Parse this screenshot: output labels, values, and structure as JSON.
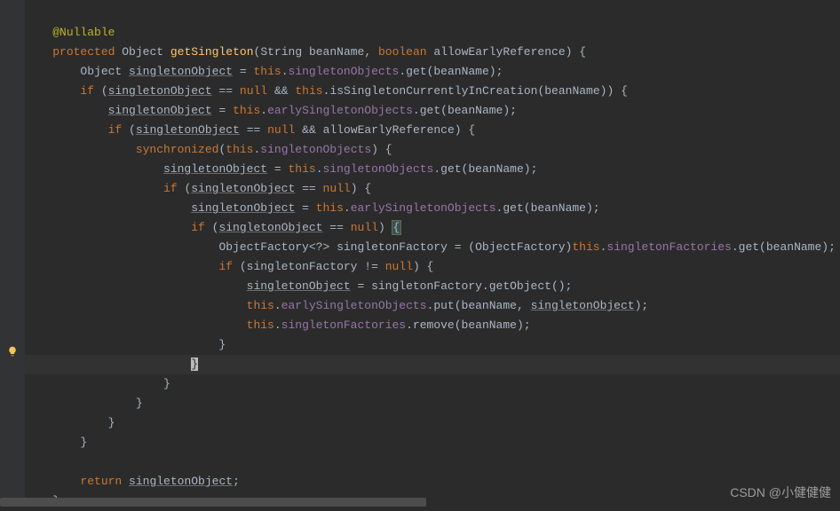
{
  "code": {
    "annotation": "@Nullable",
    "modifiers": {
      "protected": "protected",
      "object": "Object"
    },
    "methodName": "getSingleton",
    "params": {
      "stringType": "String",
      "beanName": "beanName",
      "boolType": "boolean",
      "allowEarly": "allowEarlyReference"
    },
    "kw": {
      "if": "if",
      "this": "this",
      "null": "null",
      "return": "return",
      "sync": "synchronized"
    },
    "id": {
      "singletonObject": "singletonObject",
      "singletonObjects": "singletonObjects",
      "earlySingletonObjects": "earlySingletonObjects",
      "singletonFactories": "singletonFactories",
      "singletonFactory": "singletonFactory",
      "isSingletonCurrentlyInCreation": "isSingletonCurrentlyInCreation",
      "objectFactory": "ObjectFactory",
      "get": "get",
      "put": "put",
      "remove": "remove",
      "getObject": "getObject"
    },
    "op": {
      "eq": "==",
      "ne": "!=",
      "and": "&&",
      "assign": "="
    }
  },
  "watermark": "CSDN @小健健健"
}
